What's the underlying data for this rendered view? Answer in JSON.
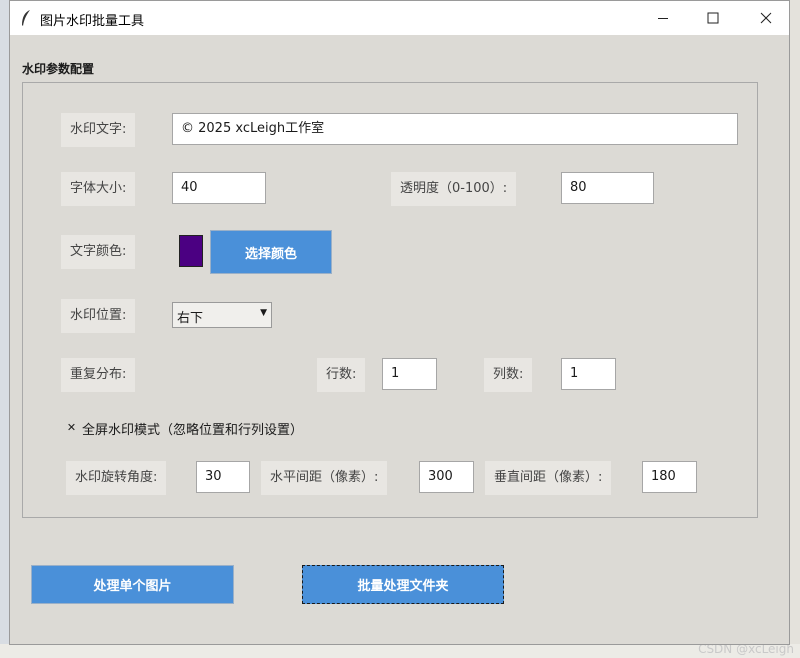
{
  "window": {
    "title": "图片水印批量工具"
  },
  "group": {
    "title": "水印参数配置"
  },
  "text": {
    "label": "水印文字:",
    "value": "© 2025 xcLeigh工作室"
  },
  "font_size": {
    "label": "字体大小:",
    "value": "40"
  },
  "opacity": {
    "label": "透明度（0-100）:",
    "value": "80"
  },
  "color": {
    "label": "文字颜色:",
    "swatch": "#4b0082",
    "button": "选择颜色"
  },
  "position": {
    "label": "水印位置:",
    "selected": "右下"
  },
  "repeat": {
    "label": "重复分布:",
    "rows_label": "行数:",
    "rows_value": "1",
    "cols_label": "列数:",
    "cols_value": "1"
  },
  "fullscreen": {
    "checked": true,
    "label": "全屏水印模式（忽略位置和行列设置）"
  },
  "rotation": {
    "label": "水印旋转角度:",
    "value": "30"
  },
  "h_spacing": {
    "label": "水平间距（像素）:",
    "value": "300"
  },
  "v_spacing": {
    "label": "垂直间距（像素）:",
    "value": "180"
  },
  "actions": {
    "single": "处理单个图片",
    "batch": "批量处理文件夹"
  },
  "credit": "CSDN @xcLeigh",
  "colors": {
    "accent": "#4a90d9",
    "background": "#dcdad5"
  }
}
